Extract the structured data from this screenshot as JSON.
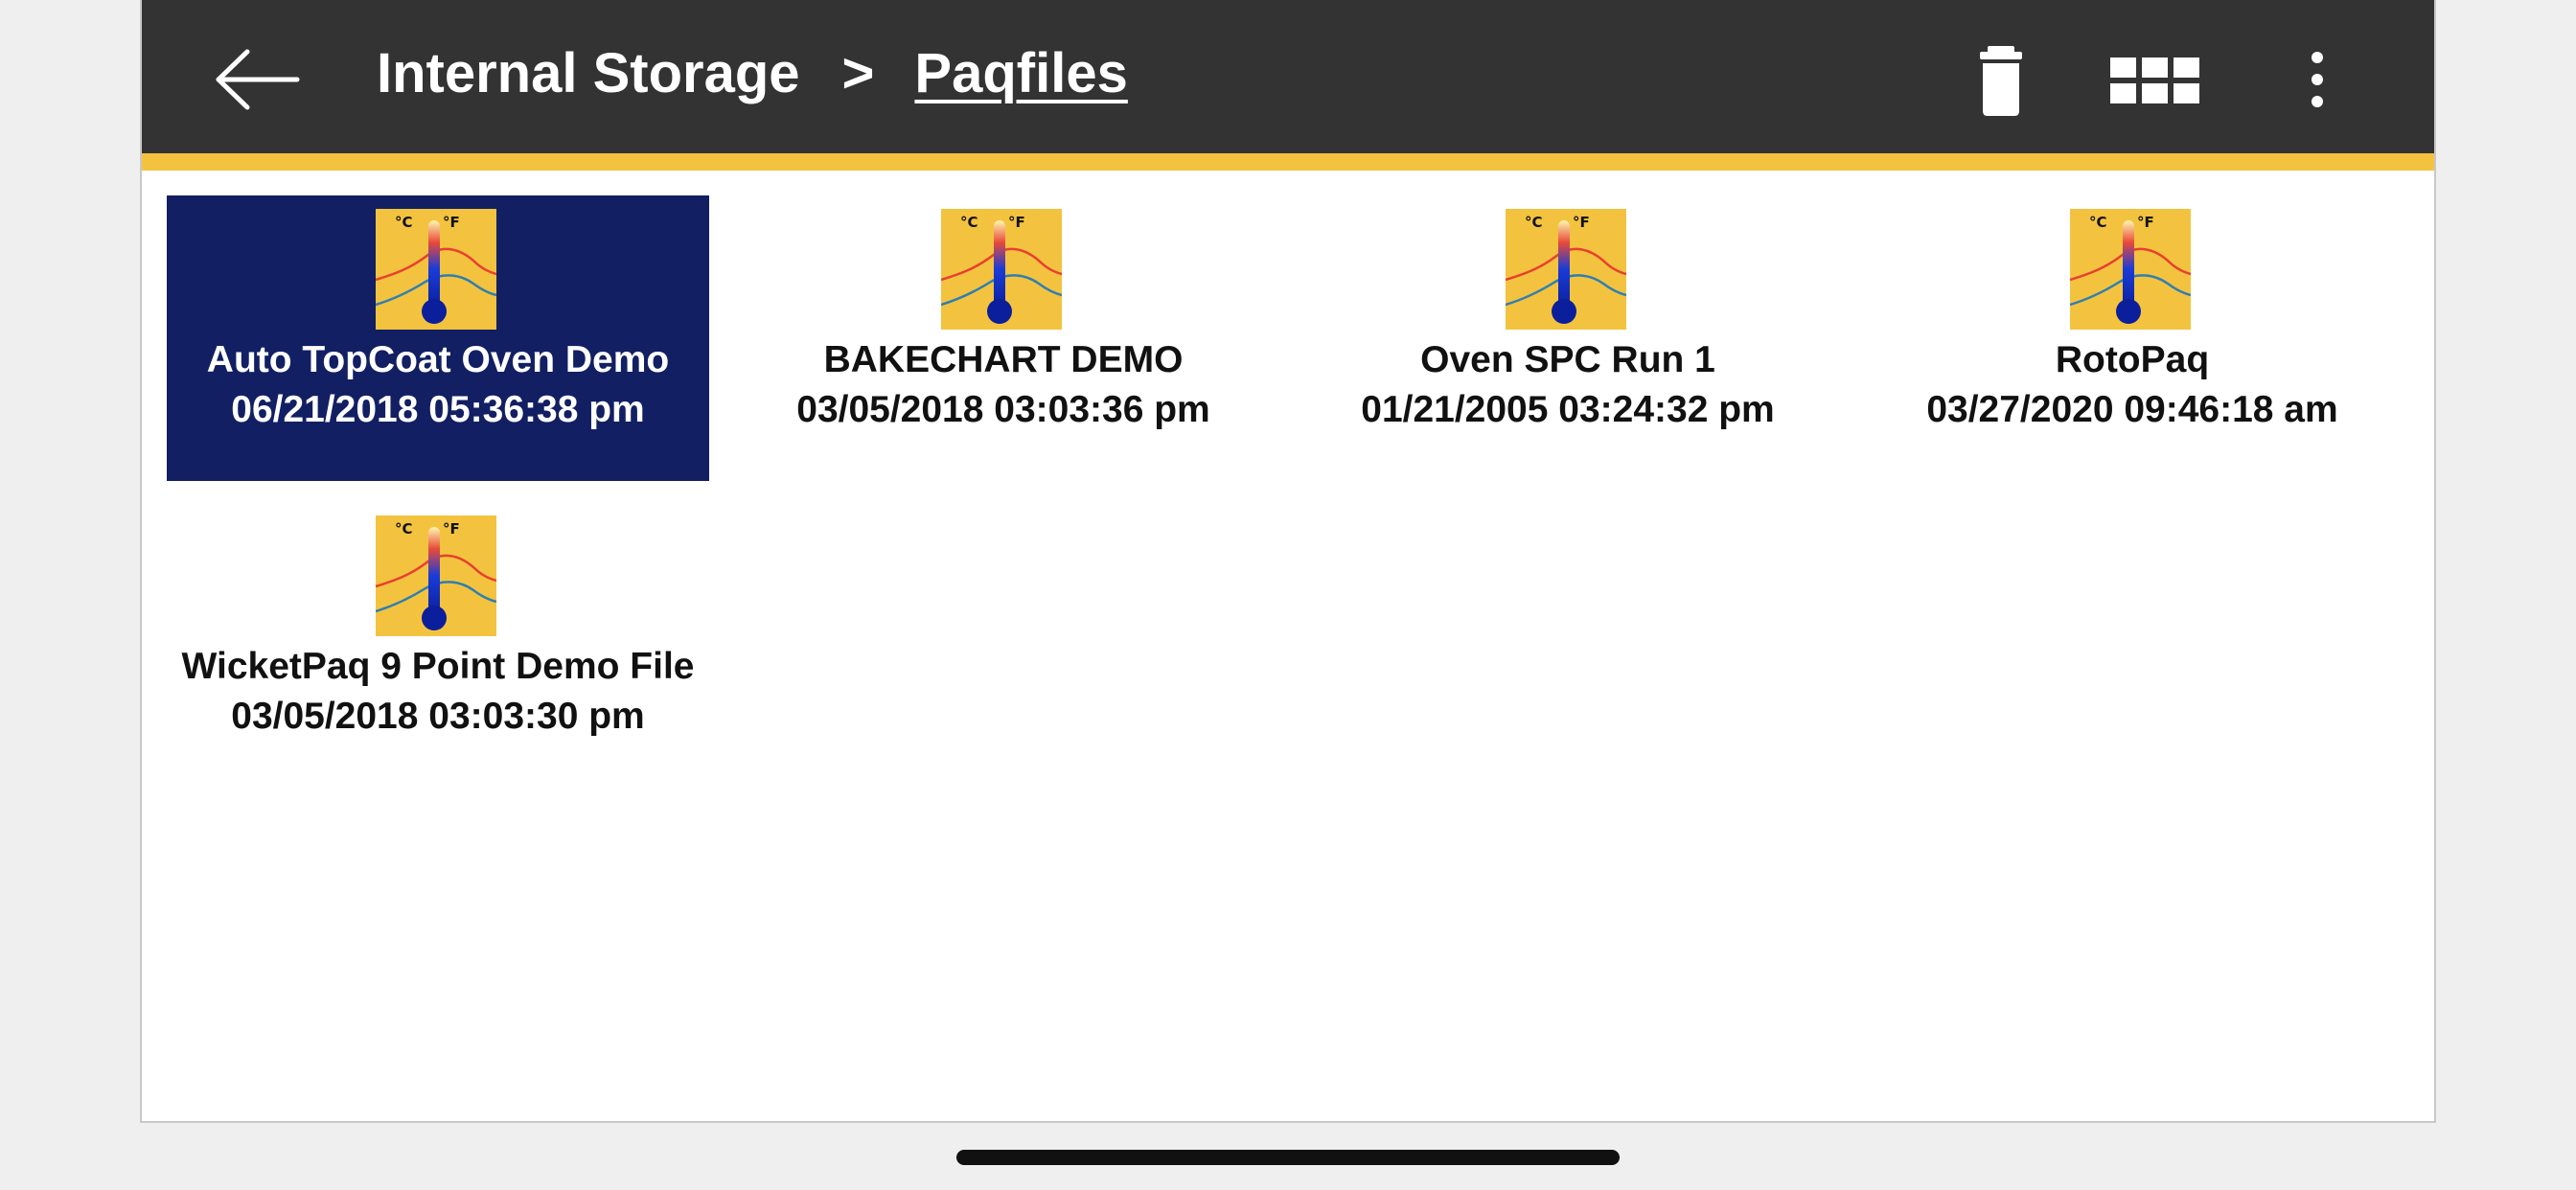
{
  "toolbar": {
    "breadcrumb_root": "Internal Storage",
    "breadcrumb_separator": ">",
    "breadcrumb_current": "Paqfiles",
    "icons": {
      "back": "back-arrow-icon",
      "delete": "trash-icon",
      "view": "grid-view-icon",
      "menu": "more-vertical-icon"
    }
  },
  "colors": {
    "toolbar_bg": "#333333",
    "accent": "#f3c33f",
    "selected_bg": "#121f63",
    "file_icon_bg": "#f3c33f"
  },
  "files": [
    {
      "name": "Auto TopCoat Oven Demo",
      "date": "06/21/2018 05:36:38 pm",
      "selected": true,
      "icon": "thermometer-chart-icon"
    },
    {
      "name": "BAKECHART DEMO",
      "date": "03/05/2018 03:03:36 pm",
      "selected": false,
      "icon": "thermometer-chart-icon"
    },
    {
      "name": "Oven SPC Run 1",
      "date": "01/21/2005 03:24:32 pm",
      "selected": false,
      "icon": "thermometer-chart-icon"
    },
    {
      "name": "RotoPaq",
      "date": "03/27/2020 09:46:18 am",
      "selected": false,
      "icon": "thermometer-chart-icon"
    },
    {
      "name": "WicketPaq 9 Point Demo File",
      "date": "03/05/2018 03:03:30 pm",
      "selected": false,
      "icon": "thermometer-chart-icon"
    }
  ],
  "file_icon_labels": {
    "celsius": "°C",
    "fahrenheit": "°F"
  }
}
